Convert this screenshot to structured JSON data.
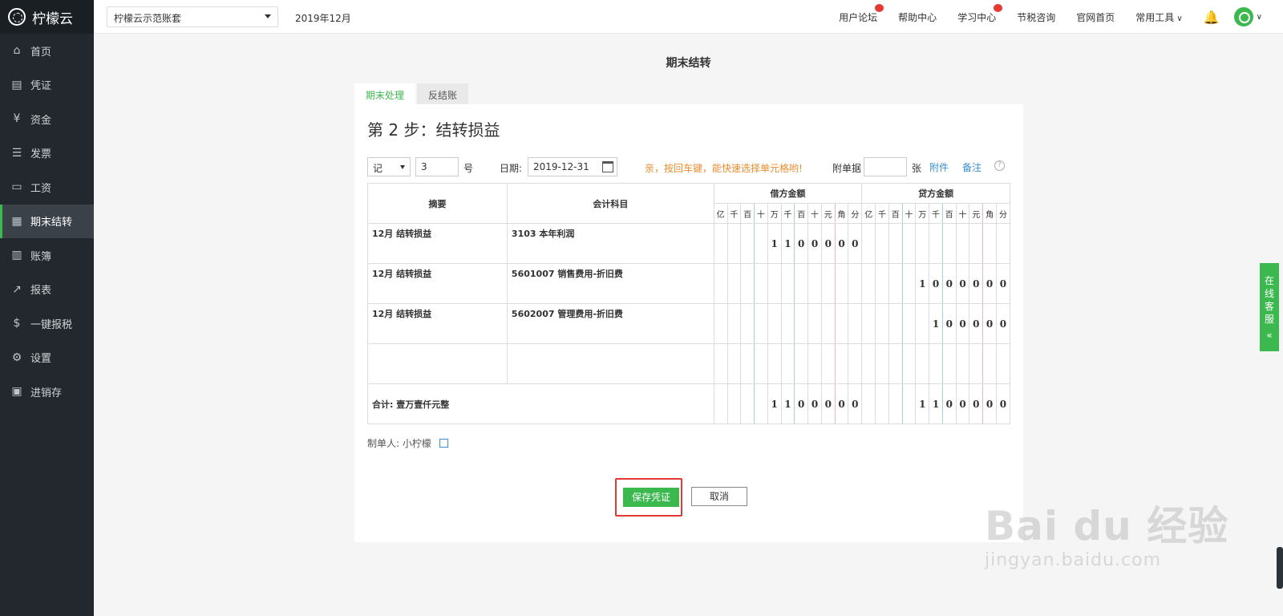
{
  "brand": {
    "name": "柠檬云"
  },
  "sidebar": {
    "items": [
      {
        "label": "首页",
        "icon": "home-icon",
        "glyph": "⌂"
      },
      {
        "label": "凭证",
        "icon": "voucher-icon",
        "glyph": "▤"
      },
      {
        "label": "资金",
        "icon": "money-icon",
        "glyph": "¥"
      },
      {
        "label": "发票",
        "icon": "invoice-icon",
        "glyph": "☰"
      },
      {
        "label": "工资",
        "icon": "salary-icon",
        "glyph": "▭"
      },
      {
        "label": "期末结转",
        "icon": "calendar-icon",
        "glyph": "▦",
        "active": true
      },
      {
        "label": "账簿",
        "icon": "book-icon",
        "glyph": "▥"
      },
      {
        "label": "报表",
        "icon": "chart-icon",
        "glyph": "↗"
      },
      {
        "label": "一键报税",
        "icon": "tax-icon",
        "glyph": "$"
      },
      {
        "label": "设置",
        "icon": "gear-icon",
        "glyph": "⚙"
      },
      {
        "label": "进销存",
        "icon": "inventory-icon",
        "glyph": "▣"
      }
    ]
  },
  "topbar": {
    "account": "柠檬云示范账套",
    "period": "2019年12月",
    "links": [
      {
        "label": "用户论坛",
        "hot": true
      },
      {
        "label": "帮助中心",
        "hot": false
      },
      {
        "label": "学习中心",
        "hot": true
      },
      {
        "label": "节税咨询",
        "hot": false
      },
      {
        "label": "官网首页",
        "hot": false
      },
      {
        "label": "常用工具",
        "hot": false,
        "dropdown": true
      }
    ]
  },
  "page": {
    "title": "期末结转",
    "tabs": [
      {
        "label": "期末处理",
        "active": true
      },
      {
        "label": "反结账",
        "active": false
      }
    ],
    "step_title": "第 2 步：结转损益"
  },
  "form": {
    "voucher_type": "记",
    "voucher_number": "3",
    "number_suffix": "号",
    "date_label": "日期:",
    "date_value": "2019-12-31",
    "hint": "亲，按回车键，能快速选择单元格哟!",
    "attach_label": "附单据",
    "attach_suffix": "张",
    "attach_link": "附件",
    "note_link": "备注"
  },
  "table": {
    "headers": {
      "summary": "摘要",
      "account": "会计科目",
      "debit": "借方金额",
      "credit": "贷方金额"
    },
    "digit_headers": [
      "亿",
      "千",
      "百",
      "十",
      "万",
      "千",
      "百",
      "十",
      "元",
      "角",
      "分"
    ],
    "rows": [
      {
        "summary": "12月 结转损益",
        "account": "3103 本年利润",
        "debit": "1100000",
        "credit": ""
      },
      {
        "summary": "12月 结转损益",
        "account": "5601007 销售费用-折旧费",
        "debit": "",
        "credit": "1000000"
      },
      {
        "summary": "12月 结转损益",
        "account": "5602007 管理费用-折旧费",
        "debit": "",
        "credit": "100000"
      },
      {
        "summary": "",
        "account": "",
        "debit": "",
        "credit": ""
      }
    ],
    "total": {
      "label": "合计: 壹万壹仟元整",
      "debit": "1100000",
      "credit": "1100000"
    }
  },
  "maker": {
    "label": "制单人: 小柠檬"
  },
  "buttons": {
    "save": "保存凭证",
    "cancel": "取消"
  },
  "service": {
    "label": "在线客服",
    "arrow": "«"
  },
  "watermark": {
    "big": "Bai du 经验",
    "small": "jingyan.baidu.com"
  }
}
